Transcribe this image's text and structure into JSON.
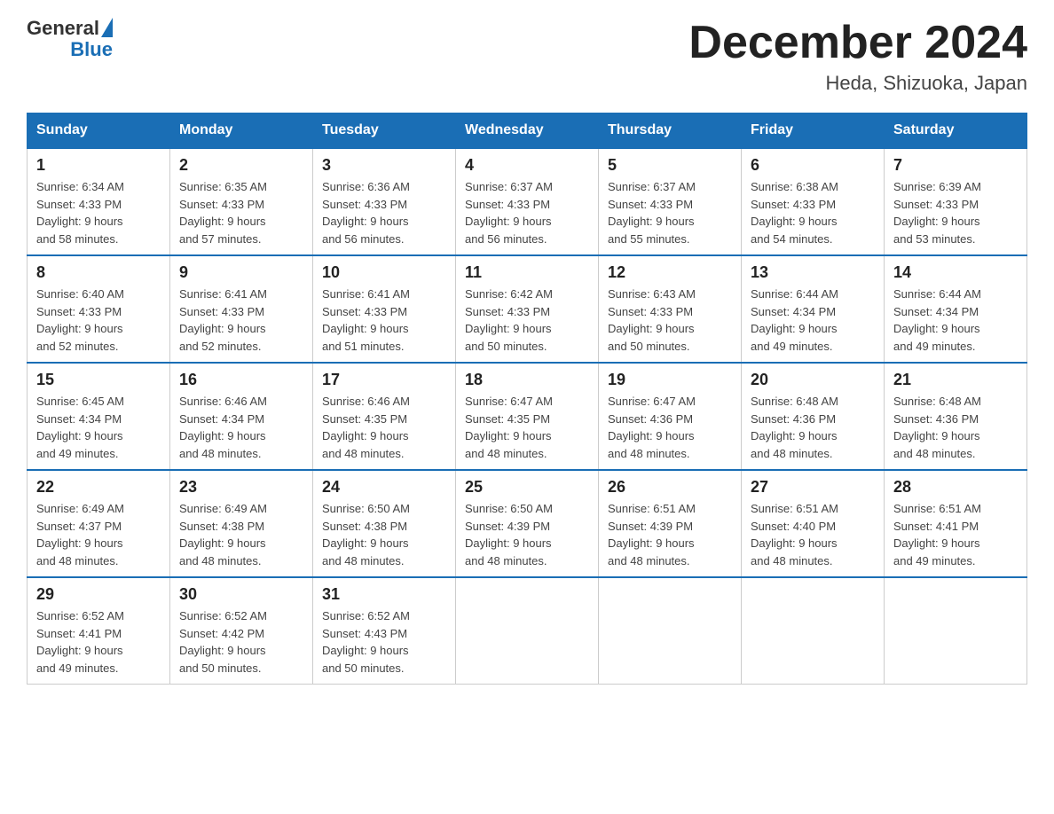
{
  "header": {
    "logo_general": "General",
    "logo_blue": "Blue",
    "month_title": "December 2024",
    "location": "Heda, Shizuoka, Japan"
  },
  "days_of_week": [
    "Sunday",
    "Monday",
    "Tuesday",
    "Wednesday",
    "Thursday",
    "Friday",
    "Saturday"
  ],
  "weeks": [
    [
      {
        "day": 1,
        "sunrise": "6:34 AM",
        "sunset": "4:33 PM",
        "daylight": "9 hours and 58 minutes."
      },
      {
        "day": 2,
        "sunrise": "6:35 AM",
        "sunset": "4:33 PM",
        "daylight": "9 hours and 57 minutes."
      },
      {
        "day": 3,
        "sunrise": "6:36 AM",
        "sunset": "4:33 PM",
        "daylight": "9 hours and 56 minutes."
      },
      {
        "day": 4,
        "sunrise": "6:37 AM",
        "sunset": "4:33 PM",
        "daylight": "9 hours and 56 minutes."
      },
      {
        "day": 5,
        "sunrise": "6:37 AM",
        "sunset": "4:33 PM",
        "daylight": "9 hours and 55 minutes."
      },
      {
        "day": 6,
        "sunrise": "6:38 AM",
        "sunset": "4:33 PM",
        "daylight": "9 hours and 54 minutes."
      },
      {
        "day": 7,
        "sunrise": "6:39 AM",
        "sunset": "4:33 PM",
        "daylight": "9 hours and 53 minutes."
      }
    ],
    [
      {
        "day": 8,
        "sunrise": "6:40 AM",
        "sunset": "4:33 PM",
        "daylight": "9 hours and 52 minutes."
      },
      {
        "day": 9,
        "sunrise": "6:41 AM",
        "sunset": "4:33 PM",
        "daylight": "9 hours and 52 minutes."
      },
      {
        "day": 10,
        "sunrise": "6:41 AM",
        "sunset": "4:33 PM",
        "daylight": "9 hours and 51 minutes."
      },
      {
        "day": 11,
        "sunrise": "6:42 AM",
        "sunset": "4:33 PM",
        "daylight": "9 hours and 50 minutes."
      },
      {
        "day": 12,
        "sunrise": "6:43 AM",
        "sunset": "4:33 PM",
        "daylight": "9 hours and 50 minutes."
      },
      {
        "day": 13,
        "sunrise": "6:44 AM",
        "sunset": "4:34 PM",
        "daylight": "9 hours and 49 minutes."
      },
      {
        "day": 14,
        "sunrise": "6:44 AM",
        "sunset": "4:34 PM",
        "daylight": "9 hours and 49 minutes."
      }
    ],
    [
      {
        "day": 15,
        "sunrise": "6:45 AM",
        "sunset": "4:34 PM",
        "daylight": "9 hours and 49 minutes."
      },
      {
        "day": 16,
        "sunrise": "6:46 AM",
        "sunset": "4:34 PM",
        "daylight": "9 hours and 48 minutes."
      },
      {
        "day": 17,
        "sunrise": "6:46 AM",
        "sunset": "4:35 PM",
        "daylight": "9 hours and 48 minutes."
      },
      {
        "day": 18,
        "sunrise": "6:47 AM",
        "sunset": "4:35 PM",
        "daylight": "9 hours and 48 minutes."
      },
      {
        "day": 19,
        "sunrise": "6:47 AM",
        "sunset": "4:36 PM",
        "daylight": "9 hours and 48 minutes."
      },
      {
        "day": 20,
        "sunrise": "6:48 AM",
        "sunset": "4:36 PM",
        "daylight": "9 hours and 48 minutes."
      },
      {
        "day": 21,
        "sunrise": "6:48 AM",
        "sunset": "4:36 PM",
        "daylight": "9 hours and 48 minutes."
      }
    ],
    [
      {
        "day": 22,
        "sunrise": "6:49 AM",
        "sunset": "4:37 PM",
        "daylight": "9 hours and 48 minutes."
      },
      {
        "day": 23,
        "sunrise": "6:49 AM",
        "sunset": "4:38 PM",
        "daylight": "9 hours and 48 minutes."
      },
      {
        "day": 24,
        "sunrise": "6:50 AM",
        "sunset": "4:38 PM",
        "daylight": "9 hours and 48 minutes."
      },
      {
        "day": 25,
        "sunrise": "6:50 AM",
        "sunset": "4:39 PM",
        "daylight": "9 hours and 48 minutes."
      },
      {
        "day": 26,
        "sunrise": "6:51 AM",
        "sunset": "4:39 PM",
        "daylight": "9 hours and 48 minutes."
      },
      {
        "day": 27,
        "sunrise": "6:51 AM",
        "sunset": "4:40 PM",
        "daylight": "9 hours and 48 minutes."
      },
      {
        "day": 28,
        "sunrise": "6:51 AM",
        "sunset": "4:41 PM",
        "daylight": "9 hours and 49 minutes."
      }
    ],
    [
      {
        "day": 29,
        "sunrise": "6:52 AM",
        "sunset": "4:41 PM",
        "daylight": "9 hours and 49 minutes."
      },
      {
        "day": 30,
        "sunrise": "6:52 AM",
        "sunset": "4:42 PM",
        "daylight": "9 hours and 50 minutes."
      },
      {
        "day": 31,
        "sunrise": "6:52 AM",
        "sunset": "4:43 PM",
        "daylight": "9 hours and 50 minutes."
      },
      null,
      null,
      null,
      null
    ]
  ]
}
